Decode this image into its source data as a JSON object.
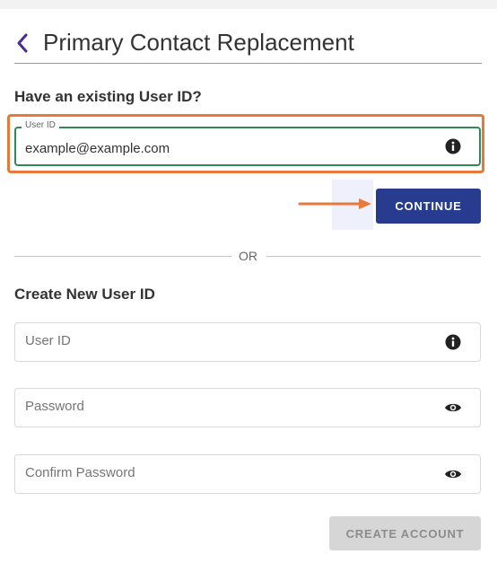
{
  "header": {
    "title": "Primary Contact Replacement",
    "back_icon": "chevron-left-icon"
  },
  "existing": {
    "heading": "Have an existing User ID?",
    "user_id_label": "User ID",
    "user_id_value": "example@example.com",
    "info_icon": "info-icon",
    "continue_label": "CONTINUE"
  },
  "divider": {
    "label": "OR"
  },
  "create": {
    "heading": "Create New User ID",
    "user_id_placeholder": "User ID",
    "password_placeholder": "Password",
    "confirm_password_placeholder": "Confirm Password",
    "eye_icon": "eye-icon",
    "create_label": "CREATE ACCOUNT"
  },
  "colors": {
    "accent": "#283c8f",
    "active_border": "#2e8b57",
    "highlight": "#e8793a",
    "disabled_bg": "#d6d6d6"
  }
}
